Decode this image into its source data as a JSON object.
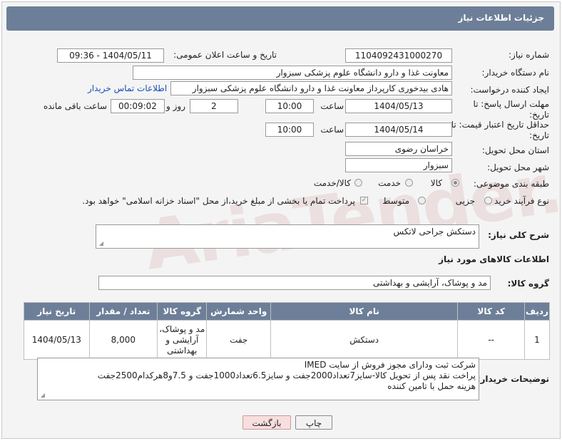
{
  "header": {
    "title": "جزئیات اطلاعات نیاز"
  },
  "watermark": "AriaTender.neT",
  "fields": {
    "need_number": {
      "label": "شماره نیاز:",
      "value": "1104092431000270"
    },
    "announce_datetime": {
      "label": "تاریخ و ساعت اعلان عمومی:",
      "value": "1404/05/11 - 09:36"
    },
    "buyer_org": {
      "label": "نام دستگاه خریدار:",
      "value": "معاونت غذا و دارو   دانشگاه علوم پزشکی سبزوار"
    },
    "requester": {
      "label": "ایجاد کننده درخواست:",
      "value": "هادی بیدخوری کارپرداز معاونت غذا و دارو   دانشگاه علوم پزشکی سبزوار",
      "contact_link": "اطلاعات تماس خریدار"
    },
    "reply_deadline": {
      "label": "مهلت ارسال پاسخ: تا تاریخ:",
      "date": "1404/05/13",
      "time_label": "ساعت",
      "time": "10:00",
      "days": "2",
      "days_label": "روز و",
      "remaining": "00:09:02",
      "remaining_label": "ساعت باقی مانده"
    },
    "price_validity": {
      "label": "حداقل تاریخ اعتبار قیمت: تا تاریخ:",
      "date": "1404/05/14",
      "time_label": "ساعت",
      "time": "10:00"
    },
    "delivery_province": {
      "label": "استان محل تحویل:",
      "value": "خراسان رضوی"
    },
    "delivery_city": {
      "label": "شهر محل تحویل:",
      "value": "سبزوار"
    },
    "category": {
      "label": "طبقه بندی موضوعی:",
      "options": [
        "کالا",
        "خدمت",
        "کالا/خدمت"
      ],
      "selected": "کالا"
    },
    "purchase_type": {
      "label": "نوع فرآیند خرید :",
      "options": [
        "جزیی",
        "متوسط"
      ],
      "note": "پرداخت تمام یا بخشی از مبلغ خرید،از محل \"اسناد خزانه اسلامی\" خواهد بود."
    }
  },
  "description": {
    "label": "شرح کلی نیاز:",
    "value": "دستکش جراحی لاتکس"
  },
  "goods_info": {
    "section_title": "اطلاعات کالاهای مورد نیاز",
    "group_label": "گروه کالا:",
    "group_value": "مد و پوشاک، آرایشی و بهداشتی",
    "columns": [
      "ردیف",
      "کد کالا",
      "نام کالا",
      "واحد شمارش",
      "گروه کالا",
      "تعداد / مقدار",
      "تاریخ نیاز"
    ],
    "rows": [
      {
        "row": "1",
        "code": "--",
        "name": "دستکش",
        "unit": "جفت",
        "group": "مد و پوشاک، آرایشی و بهداشتی",
        "qty": "8,000",
        "date": "1404/05/13"
      }
    ]
  },
  "buyer_notes": {
    "label": "توضیحات خریدار:",
    "lines": [
      "شرکت ثبت ودارای مجوز فروش از سایت IMED",
      "پراخت نقد پس از تحویل کالا-سایز7تعداد2000جفت و سایز6.5تعداد1000جفت و 7.5و8هرکدام2500جفت",
      "هزینه حمل با تامین کننده"
    ]
  },
  "buttons": {
    "print": "چاپ",
    "back": "بازگشت"
  }
}
